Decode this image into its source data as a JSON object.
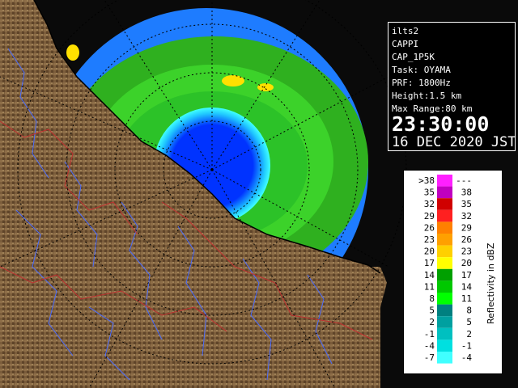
{
  "info": {
    "site": "ilts2",
    "product": "CAPPI",
    "product_code": "CAP_1P5K",
    "task": "Task: OYAMA",
    "prf": "PRF: 1800Hz",
    "height": "Height:1.5 km",
    "max_range": "Max Range:80 km",
    "time": "23:30:00",
    "date": "16 DEC 2020 JST"
  },
  "legend": {
    "title": "Reflectivity in dBZ",
    "rows": [
      {
        "low": ">38",
        "high": "---",
        "color": "#ff20ff"
      },
      {
        "low": "35",
        "high": "38",
        "color": "#c000c0"
      },
      {
        "low": "32",
        "high": "35",
        "color": "#d00000"
      },
      {
        "low": "29",
        "high": "32",
        "color": "#ff2020"
      },
      {
        "low": "26",
        "high": "29",
        "color": "#ff8000"
      },
      {
        "low": "23",
        "high": "26",
        "color": "#ffa000"
      },
      {
        "low": "20",
        "high": "23",
        "color": "#ffd000"
      },
      {
        "low": "17",
        "high": "20",
        "color": "#ffff00"
      },
      {
        "low": "14",
        "high": "17",
        "color": "#00a000"
      },
      {
        "low": "11",
        "high": "14",
        "color": "#00c800"
      },
      {
        "low": "8",
        "high": "11",
        "color": "#00ff00"
      },
      {
        "low": "5",
        "high": "8",
        "color": "#008080"
      },
      {
        "low": "2",
        "high": "5",
        "color": "#00a0a0"
      },
      {
        "low": "-1",
        "high": "2",
        "color": "#00c0c0"
      },
      {
        "low": "-4",
        "high": "-1",
        "color": "#00e0e0"
      },
      {
        "low": "-7",
        "high": "-4",
        "color": "#40ffff"
      }
    ]
  },
  "colors": {
    "sea": "#0022ff",
    "land": "#7a5c3a",
    "coverage_ring": "#2a8cff",
    "coastline": "#000000",
    "range_rings": "#000000"
  }
}
